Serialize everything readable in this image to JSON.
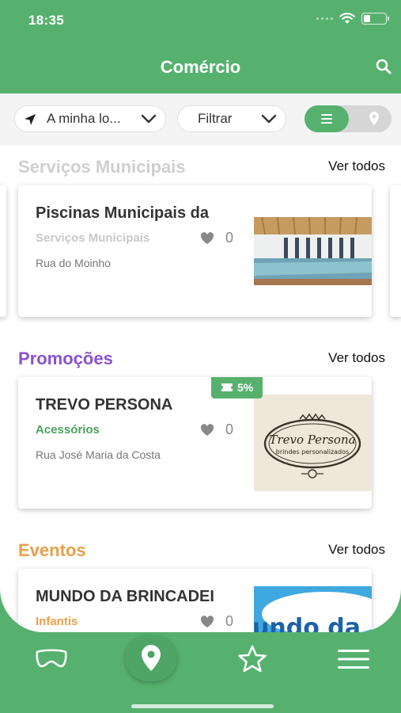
{
  "status_bar": {
    "time": "18:35"
  },
  "header": {
    "title": "Comércio"
  },
  "toolbar": {
    "location_label": "A minha lo...",
    "filter_label": "Filtrar"
  },
  "sections": [
    {
      "title": "Serviços Municipais",
      "see_all": "Ver todos",
      "color": "#cfcfcf",
      "card": {
        "name": "Piscinas Municipais da",
        "category": "Serviços Municipais",
        "category_color": "#c8c8c8",
        "likes": "0",
        "address": "Rua do Moinho"
      }
    },
    {
      "title": "Promoções",
      "see_all": "Ver todos",
      "color": "#8a52cf",
      "card": {
        "name": "TREVO PERSONA",
        "category": "Acessórios",
        "category_color": "#4aa35d",
        "likes": "0",
        "address": "Rua José Maria da Costa",
        "badge": "5%",
        "image_line1": "Trevo Persona",
        "image_line2": "brindes personalizados"
      }
    },
    {
      "title": "Eventos",
      "see_all": "Ver todos",
      "color": "#e8a04a",
      "card": {
        "name": "MUNDO DA BRINCADEI",
        "category": "Infantis",
        "category_color": "#e8a04a",
        "likes": "0",
        "image_text": "undo da"
      }
    }
  ],
  "icons": {
    "search": "search-icon",
    "location": "navigation-arrow-icon",
    "chevron": "chevron-down-icon",
    "list": "list-view-icon",
    "map": "map-pin-icon",
    "heart": "heart-icon",
    "ticket": "ticket-icon",
    "tabs": [
      "mask-icon",
      "map-pin-icon",
      "star-icon",
      "menu-icon"
    ]
  },
  "colors": {
    "primary": "#56b16e",
    "promo": "#8a52cf",
    "events": "#e8a04a"
  }
}
